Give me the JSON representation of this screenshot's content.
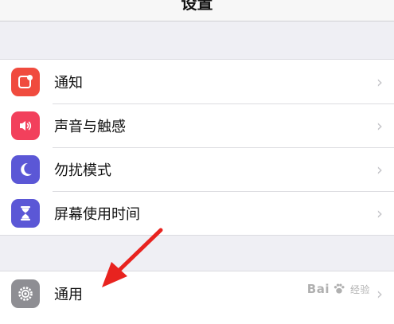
{
  "nav": {
    "title": "设置"
  },
  "group1": {
    "items": [
      {
        "label": "通知",
        "icon": "notifications-icon",
        "color": "#f04b3e"
      },
      {
        "label": "声音与触感",
        "icon": "speaker-icon",
        "color": "#f2405c"
      },
      {
        "label": "勿扰模式",
        "icon": "moon-icon",
        "color": "#5b57d6"
      },
      {
        "label": "屏幕使用时间",
        "icon": "hourglass-icon",
        "color": "#5b57d6"
      }
    ]
  },
  "group2": {
    "items": [
      {
        "label": "通用",
        "icon": "gear-icon",
        "color": "#8e8e93"
      }
    ]
  },
  "chevron": "›",
  "annotation": {
    "arrow_color": "#e8231f"
  },
  "watermark": {
    "brand": "Bai",
    "suffix": "经验"
  }
}
